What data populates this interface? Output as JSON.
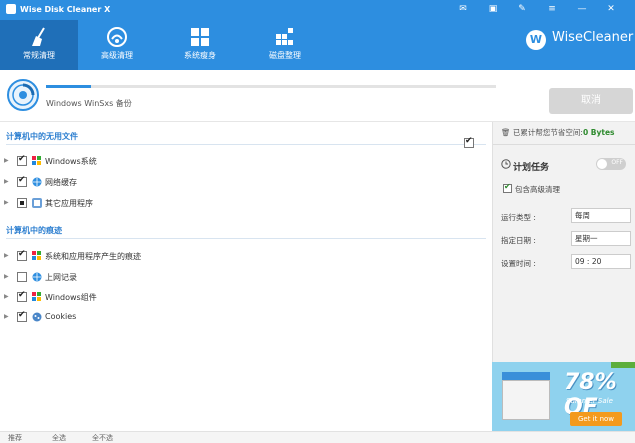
{
  "app": {
    "title": "Wise Disk Cleaner X",
    "brand": "WiseCleaner",
    "brand_mark": "W"
  },
  "window_controls": {
    "mail": "✉",
    "skin": "▣",
    "tools": "✎",
    "menu": "≡",
    "minimize": "—",
    "close": "✕"
  },
  "tabs": [
    {
      "label": "常规清理",
      "icon": "broom-icon",
      "active": true
    },
    {
      "label": "高级清理",
      "icon": "wifi-clean-icon",
      "active": false
    },
    {
      "label": "系统瘦身",
      "icon": "windows-icon",
      "active": false
    },
    {
      "label": "磁盘整理",
      "icon": "defrag-icon",
      "active": false
    }
  ],
  "scan": {
    "status": "Windows WinSxs 备份",
    "progress": 0.1,
    "cancel_label": "取消"
  },
  "sections": [
    {
      "title": "计算机中的无用文件",
      "items": [
        {
          "label": "Windows系统",
          "icon": "windows-icon",
          "state": "checked"
        },
        {
          "label": "网络缓存",
          "icon": "globe-icon",
          "state": "checked"
        },
        {
          "label": "其它应用程序",
          "icon": "apps-icon",
          "state": "partial"
        }
      ]
    },
    {
      "title": "计算机中的痕迹",
      "items": [
        {
          "label": "系统和应用程序产生的痕迹",
          "icon": "windows-icon",
          "state": "checked"
        },
        {
          "label": "上网记录",
          "icon": "globe-icon",
          "state": "unchecked"
        },
        {
          "label": "Windows组件",
          "icon": "windows-icon",
          "state": "checked"
        },
        {
          "label": "Cookies",
          "icon": "cookie-icon",
          "state": "checked"
        }
      ]
    }
  ],
  "panel": {
    "saved_prefix": "已累计帮您节省空间:",
    "saved_value": "0 Bytes",
    "schedule_title": "计划任务",
    "toggle_label": "OFF",
    "include_advanced": "包含高级清理",
    "fields": [
      {
        "label": "运行类型 :",
        "value": "每周"
      },
      {
        "label": "指定日期 :",
        "value": "星期一"
      },
      {
        "label": "设置时间 :",
        "value": "09 : 20"
      }
    ]
  },
  "ad": {
    "percent": "78% OF",
    "sub": "Summer Sale",
    "button": "Get it now"
  },
  "bottom": {
    "select_all": "推荐",
    "select_none": "全选",
    "invert": "全不选"
  },
  "colors": {
    "header": "#2d8ee0",
    "accent": "#2d7fd0"
  }
}
